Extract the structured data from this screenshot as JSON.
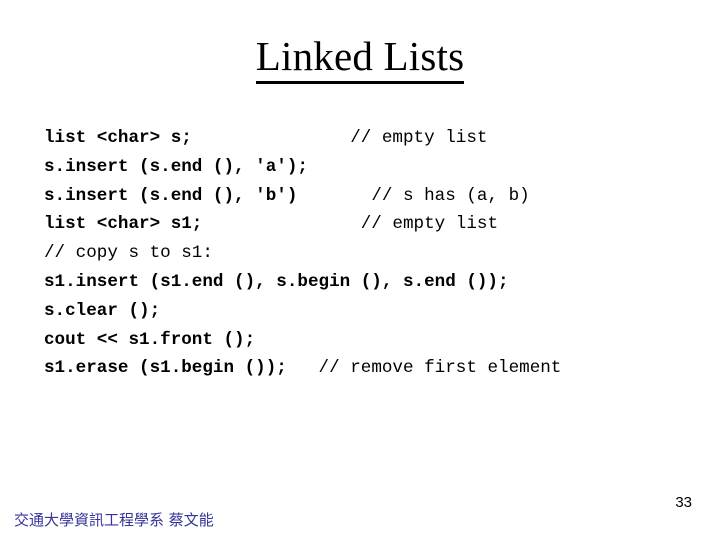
{
  "slide": {
    "title": "Linked Lists",
    "page_number": "33",
    "footer": "交通大學資訊工程學系 蔡文能",
    "footer_color": "#333399",
    "background_color": "#ffffff",
    "text_color": "#000000"
  },
  "code_block": {
    "language": "cpp",
    "lines": [
      {
        "code": "list <char> s;",
        "comment": "// empty list",
        "comment_col": 29
      },
      {
        "code": "s.insert (s.end (), 'a');",
        "comment": "",
        "comment_col": 0
      },
      {
        "code": "s.insert (s.end (), 'b')",
        "comment": "// s has (a, b)",
        "comment_col": 31
      },
      {
        "code": "list <char> s1;",
        "comment": "// empty list",
        "comment_col": 30
      },
      {
        "code": "",
        "comment": "// copy s to s1:",
        "comment_col": 0
      },
      {
        "code": "s1.insert (s1.end (), s.begin (), s.end ());",
        "comment": "",
        "comment_col": 0
      },
      {
        "code": "s.clear ();",
        "comment": "",
        "comment_col": 0
      },
      {
        "code": "cout << s1.front ();",
        "comment": "",
        "comment_col": 0
      },
      {
        "code": "s1.erase (s1.begin ());",
        "comment": "// remove first element",
        "comment_col": 26
      }
    ]
  }
}
